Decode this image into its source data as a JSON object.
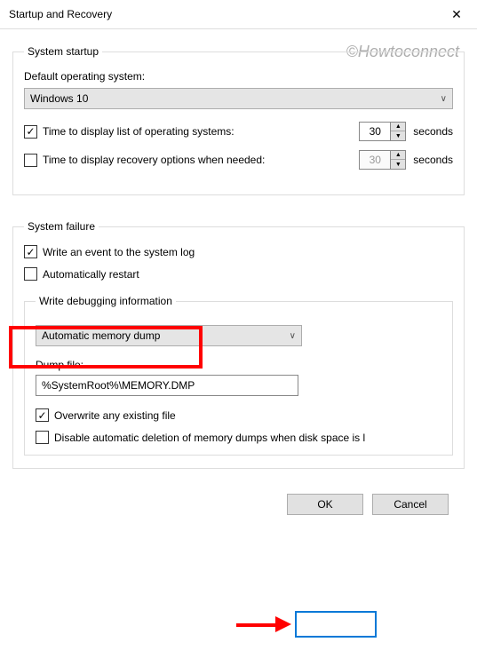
{
  "titlebar": {
    "title": "Startup and Recovery"
  },
  "watermark": "©Howtoconnect",
  "startup": {
    "legend": "System startup",
    "default_os_label": "Default operating system:",
    "default_os_value": "Windows 10",
    "time_list_label": "Time to display list of operating systems:",
    "time_list_value": "30",
    "time_recovery_label": "Time to display recovery options when needed:",
    "time_recovery_value": "30",
    "seconds_suffix": "seconds"
  },
  "failure": {
    "legend": "System failure",
    "write_event_label": "Write an event to the system log",
    "auto_restart_label": "Automatically restart",
    "debug_legend": "Write debugging information",
    "dump_type": "Automatic memory dump",
    "dump_file_label": "Dump file:",
    "dump_file_value": "%SystemRoot%\\MEMORY.DMP",
    "overwrite_label": "Overwrite any existing file",
    "disable_delete_label": "Disable automatic deletion of memory dumps when disk space is l"
  },
  "buttons": {
    "ok": "OK",
    "cancel": "Cancel"
  }
}
